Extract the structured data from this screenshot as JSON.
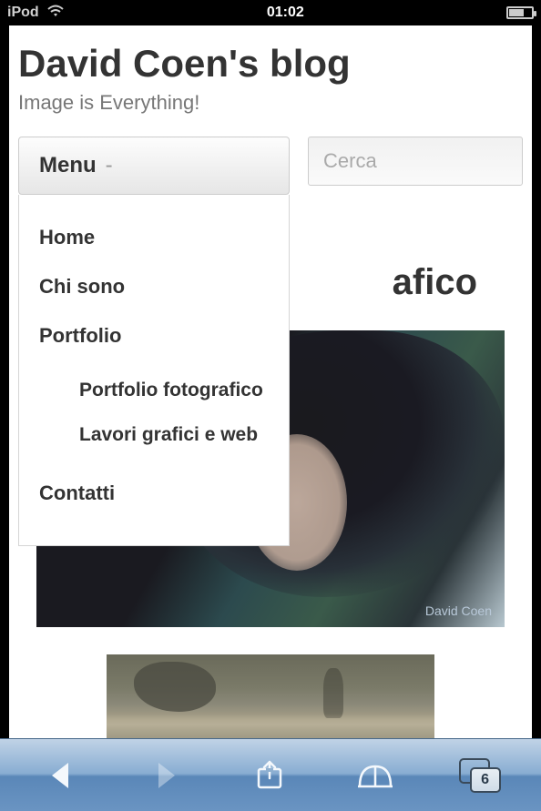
{
  "status": {
    "carrier": "iPod",
    "time": "01:02"
  },
  "blog": {
    "title": "David Coen's blog",
    "tagline": "Image is Everything!"
  },
  "menu": {
    "label": "Menu",
    "dash": "-",
    "items": {
      "home": "Home",
      "about": "Chi sono",
      "portfolio": "Portfolio",
      "portfolio_sub": {
        "photo": "Portfolio fotografico",
        "graphics": "Lavori grafici e web"
      },
      "contact": "Contatti"
    }
  },
  "search": {
    "placeholder": "Cerca"
  },
  "post": {
    "title_visible_fragment": "afico"
  },
  "hero": {
    "watermark": "David Coen"
  },
  "toolbar": {
    "tab_count": "6"
  }
}
